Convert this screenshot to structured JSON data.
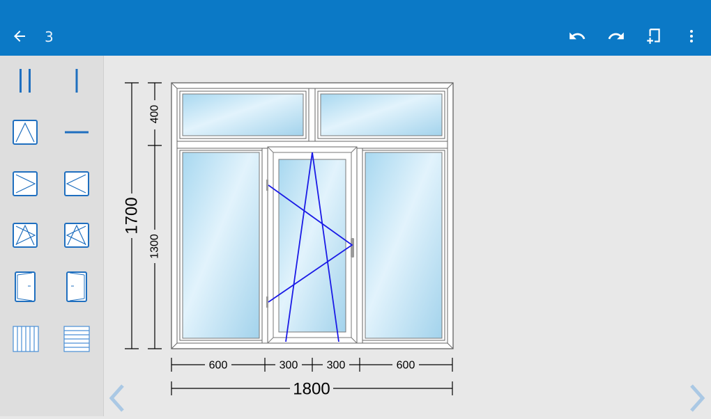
{
  "app_bar": {
    "page_number": "3",
    "back_icon": "arrow-left-icon",
    "actions": [
      {
        "name": "undo-button",
        "icon": "undo-icon"
      },
      {
        "name": "redo-button",
        "icon": "redo-icon"
      },
      {
        "name": "add-page-button",
        "icon": "add-page-icon"
      },
      {
        "name": "more-menu-button",
        "icon": "more-vert-icon"
      }
    ]
  },
  "tools": [
    {
      "name": "tool-double-mullion",
      "icon": "double-mullion-icon"
    },
    {
      "name": "tool-vertical-mullion",
      "icon": "vertical-mullion-icon"
    },
    {
      "name": "tool-sash-top-hung",
      "icon": "sash-top-hung-icon"
    },
    {
      "name": "tool-horizontal-transom",
      "icon": "horizontal-transom-icon"
    },
    {
      "name": "tool-sash-left-hinged",
      "icon": "sash-left-hinged-icon"
    },
    {
      "name": "tool-sash-right-hinged",
      "icon": "sash-right-hinged-icon"
    },
    {
      "name": "tool-tilt-turn-left",
      "icon": "tilt-turn-left-icon"
    },
    {
      "name": "tool-tilt-turn-right",
      "icon": "tilt-turn-right-icon"
    },
    {
      "name": "tool-door-left",
      "icon": "door-left-icon"
    },
    {
      "name": "tool-door-right",
      "icon": "door-right-icon"
    },
    {
      "name": "tool-vertical-blinds",
      "icon": "vertical-blinds-icon"
    },
    {
      "name": "tool-horizontal-blinds",
      "icon": "horizontal-blinds-icon"
    }
  ],
  "drawing": {
    "dimensions": {
      "total_height": "1700",
      "top_height": "400",
      "bottom_height": "1300",
      "total_width": "1800",
      "widths": [
        "600",
        "300",
        "300",
        "600"
      ]
    }
  },
  "colors": {
    "app_bar": "#0b79c6",
    "tool_icon": "#1f6fbf",
    "opening_lines": "#1a1ae6",
    "glass": "#c6e6f6",
    "nav_arrow": "#aac8e4"
  },
  "nav": {
    "prev_icon": "chevron-left-icon",
    "next_icon": "chevron-right-icon"
  }
}
